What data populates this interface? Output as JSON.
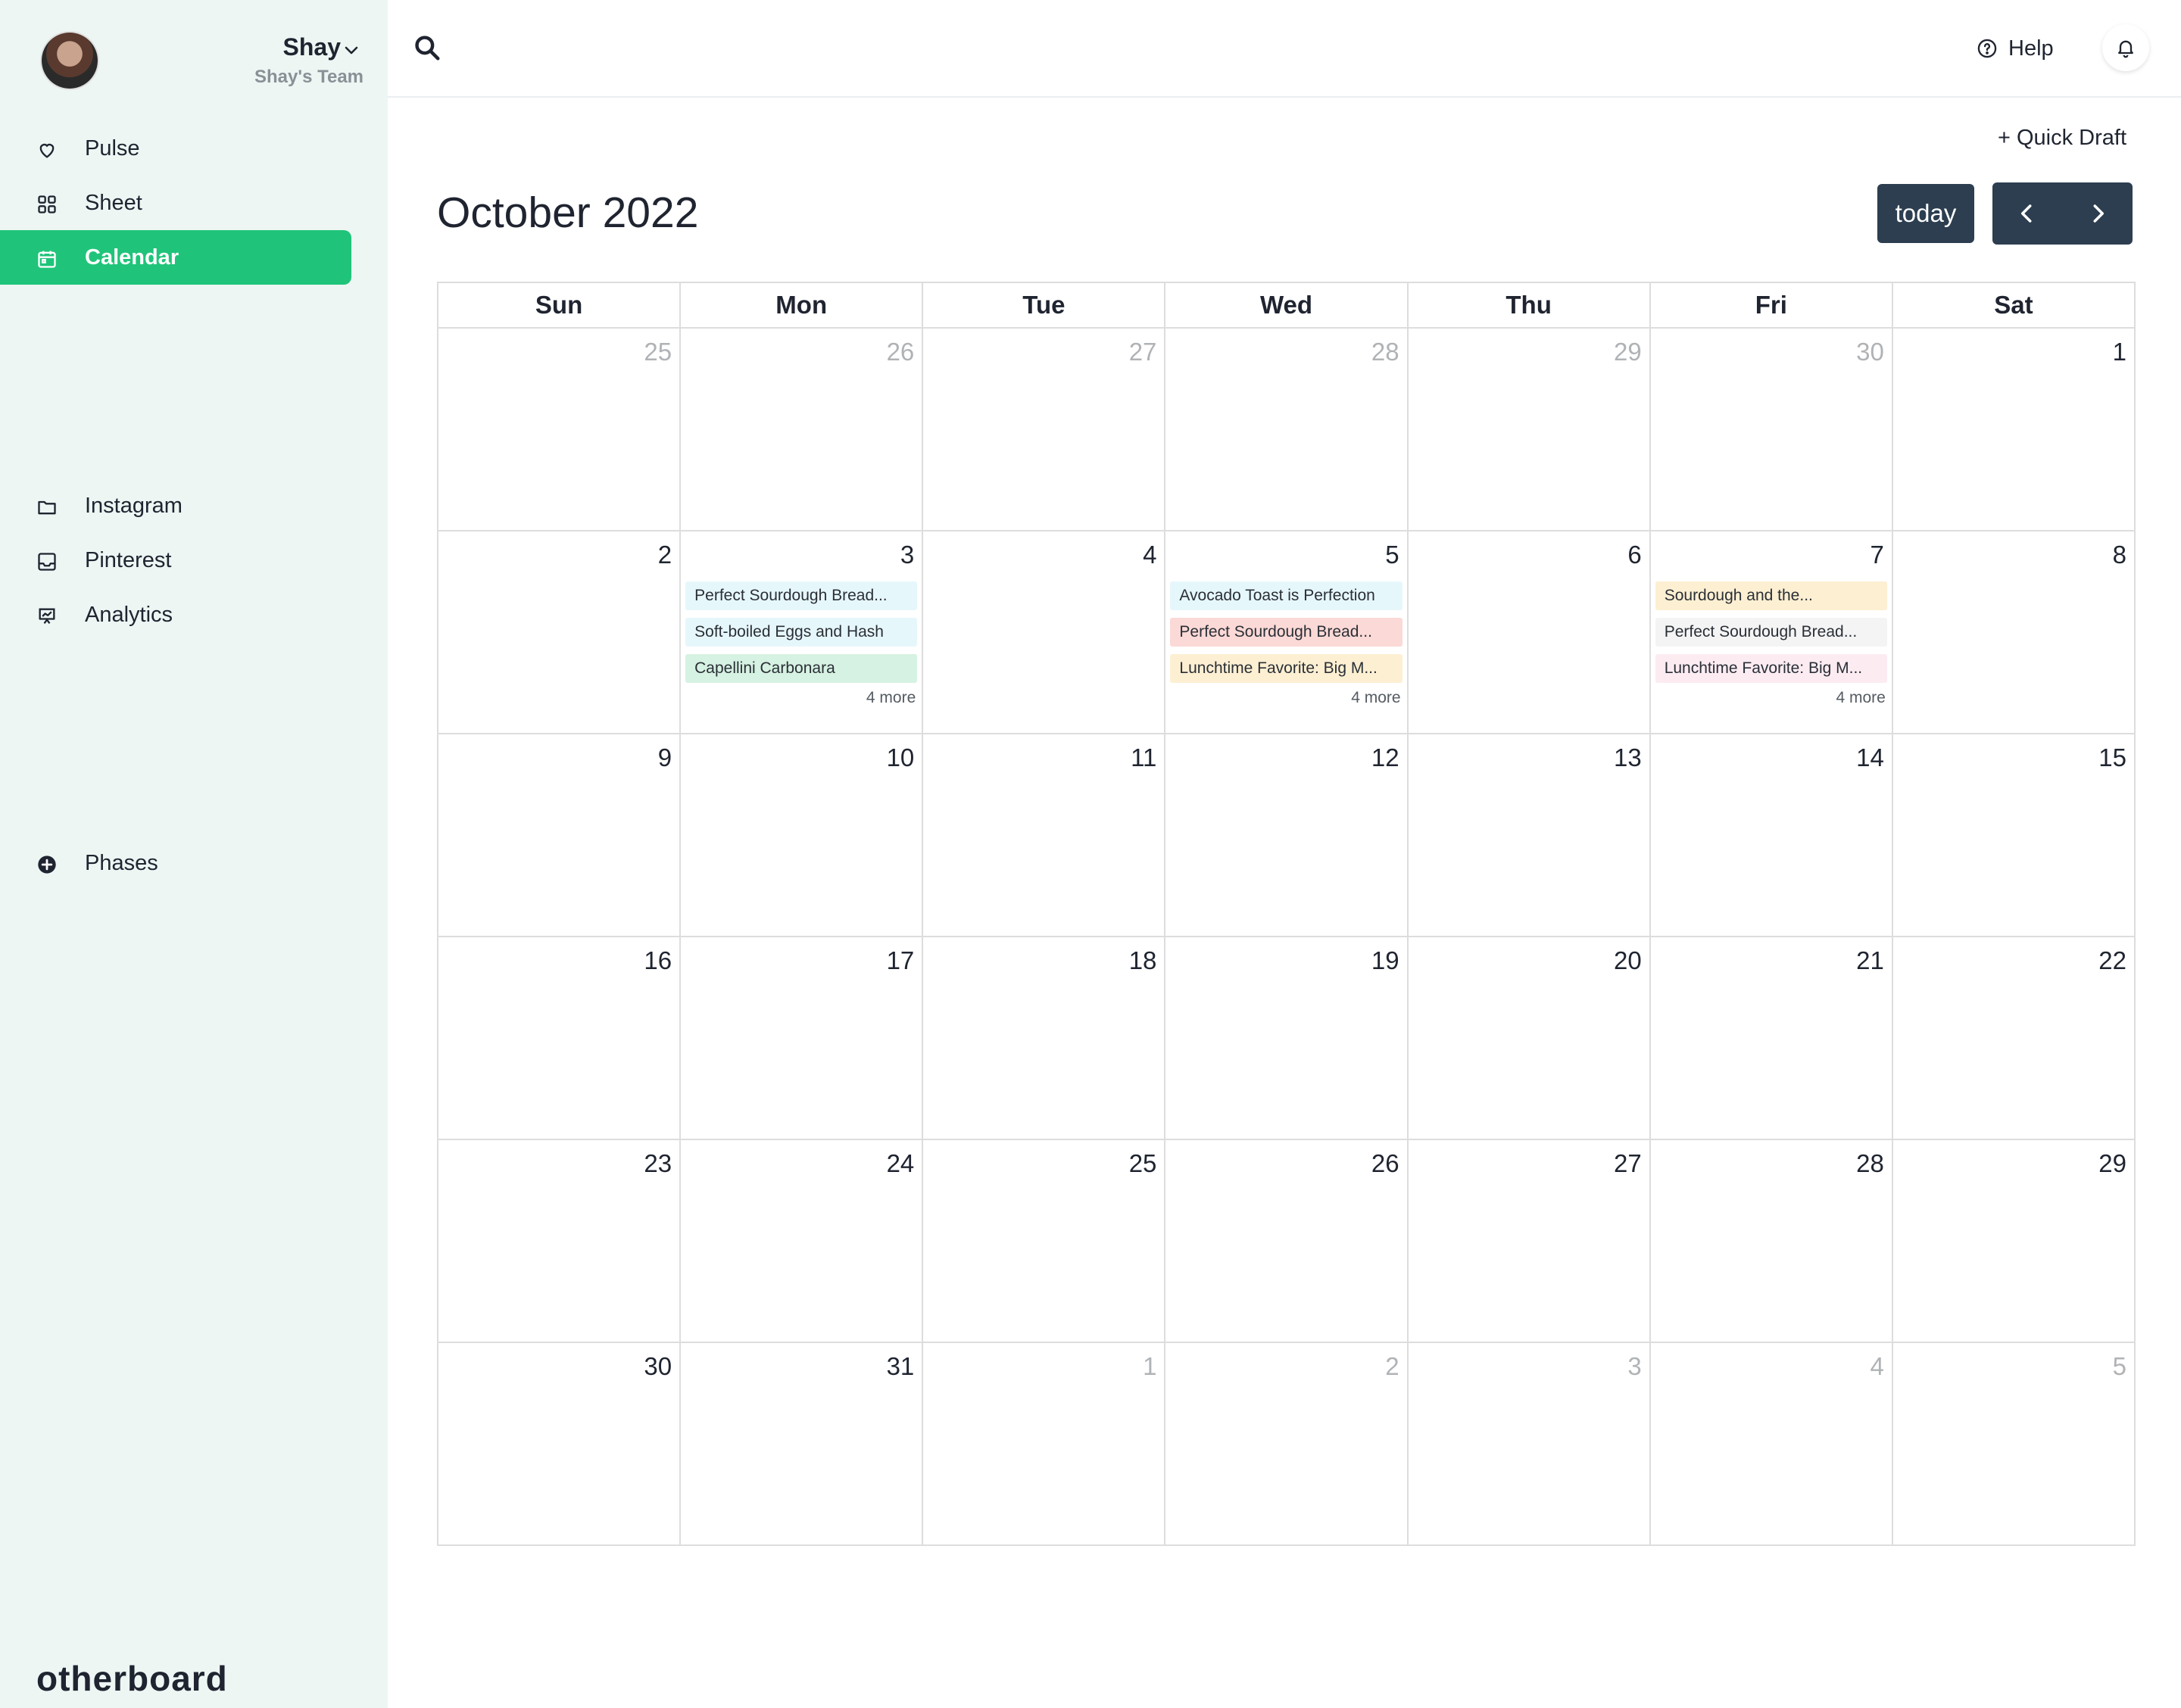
{
  "user": {
    "name": "Shay",
    "team": "Shay's Team"
  },
  "nav": {
    "primary": [
      {
        "label": "Pulse",
        "icon": "heart-icon"
      },
      {
        "label": "Sheet",
        "icon": "grid-icon"
      },
      {
        "label": "Calendar",
        "icon": "calendar-icon",
        "active": true
      }
    ],
    "channels": [
      {
        "label": "Instagram",
        "icon": "folder-icon"
      },
      {
        "label": "Pinterest",
        "icon": "inbox-icon"
      },
      {
        "label": "Analytics",
        "icon": "presentation-chart-icon"
      }
    ],
    "phases": {
      "label": "Phases",
      "icon": "plus-circle-icon"
    }
  },
  "brand": "otherboard",
  "topbar": {
    "help_label": "Help"
  },
  "main": {
    "quick_draft": "+ Quick Draft",
    "month_title": "October 2022",
    "today_label": "today"
  },
  "calendar": {
    "day_headers": [
      "Sun",
      "Mon",
      "Tue",
      "Wed",
      "Thu",
      "Fri",
      "Sat"
    ],
    "weeks": [
      [
        {
          "n": "25",
          "o": true
        },
        {
          "n": "26",
          "o": true
        },
        {
          "n": "27",
          "o": true
        },
        {
          "n": "28",
          "o": true
        },
        {
          "n": "29",
          "o": true
        },
        {
          "n": "30",
          "o": true
        },
        {
          "n": "1"
        }
      ],
      [
        {
          "n": "2"
        },
        {
          "n": "3",
          "events": [
            {
              "t": "Perfect Sourdough Bread...",
              "c": "#e6f7fb"
            },
            {
              "t": "Soft-boiled Eggs and Hash",
              "c": "#e6f7fb"
            },
            {
              "t": "Capellini Carbonara",
              "c": "#d6f2e2"
            }
          ],
          "more": "4 more"
        },
        {
          "n": "4"
        },
        {
          "n": "5",
          "events": [
            {
              "t": "Avocado Toast is Perfection",
              "c": "#e6f7fb"
            },
            {
              "t": "Perfect Sourdough Bread...",
              "c": "#fbd9d6"
            },
            {
              "t": "Lunchtime Favorite: Big M...",
              "c": "#fdefd2"
            }
          ],
          "more": "4 more"
        },
        {
          "n": "6"
        },
        {
          "n": "7",
          "events": [
            {
              "t": "Sourdough and the...",
              "c": "#fdefd2"
            },
            {
              "t": "Perfect Sourdough Bread...",
              "c": "#f4f4f4"
            },
            {
              "t": "Lunchtime Favorite: Big M...",
              "c": "#fcecf2"
            }
          ],
          "more": "4 more"
        },
        {
          "n": "8"
        }
      ],
      [
        {
          "n": "9"
        },
        {
          "n": "10"
        },
        {
          "n": "11"
        },
        {
          "n": "12"
        },
        {
          "n": "13"
        },
        {
          "n": "14"
        },
        {
          "n": "15"
        }
      ],
      [
        {
          "n": "16"
        },
        {
          "n": "17"
        },
        {
          "n": "18"
        },
        {
          "n": "19"
        },
        {
          "n": "20"
        },
        {
          "n": "21"
        },
        {
          "n": "22"
        }
      ],
      [
        {
          "n": "23"
        },
        {
          "n": "24"
        },
        {
          "n": "25"
        },
        {
          "n": "26"
        },
        {
          "n": "27"
        },
        {
          "n": "28"
        },
        {
          "n": "29"
        }
      ],
      [
        {
          "n": "30"
        },
        {
          "n": "31"
        },
        {
          "n": "1",
          "o": true
        },
        {
          "n": "2",
          "o": true
        },
        {
          "n": "3",
          "o": true
        },
        {
          "n": "4",
          "o": true
        },
        {
          "n": "5",
          "o": true
        }
      ]
    ]
  },
  "colors": {
    "accent": "#1fc47a",
    "button": "#2c3e50",
    "sidebar": "#edf6f3"
  }
}
